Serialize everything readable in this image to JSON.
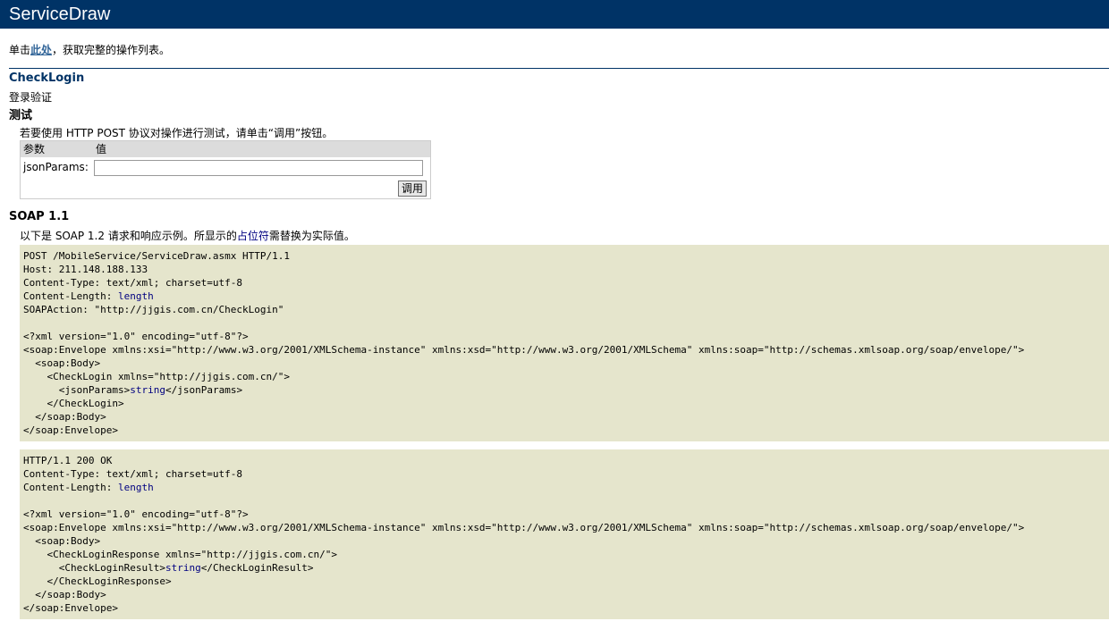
{
  "service": {
    "name": "ServiceDraw"
  },
  "intro": {
    "prefix": "单击",
    "link": "此处",
    "suffix": "，获取完整的操作列表。"
  },
  "operation": {
    "name": "CheckLogin",
    "description": "登录验证"
  },
  "test": {
    "heading": "测试",
    "instructions": "若要使用 HTTP POST 协议对操作进行测试，请单击“调用”按钮。",
    "col_param": "参数",
    "col_value": "值",
    "param_name": "jsonParams:",
    "param_value": "",
    "invoke_label": "调用"
  },
  "soap": {
    "heading": "SOAP 1.1",
    "note_a": "以下是 SOAP 1.2 请求和响应示例。所显示的",
    "note_link": "占位符",
    "note_b": "需替换为实际值。",
    "request": {
      "line1": "POST /MobileService/ServiceDraw.asmx HTTP/1.1",
      "line2": "Host: 211.148.188.133",
      "line3": "Content-Type: text/xml; charset=utf-8",
      "line4_prefix": "Content-Length: ",
      "line4_value": "length",
      "line5": "SOAPAction: \"http://jjgis.com.cn/CheckLogin\"",
      "line6": "<?xml version=\"1.0\" encoding=\"utf-8\"?>",
      "line7": "<soap:Envelope xmlns:xsi=\"http://www.w3.org/2001/XMLSchema-instance\" xmlns:xsd=\"http://www.w3.org/2001/XMLSchema\" xmlns:soap=\"http://schemas.xmlsoap.org/soap/envelope/\">",
      "line8": "  <soap:Body>",
      "line9": "    <CheckLogin xmlns=\"http://jjgis.com.cn/\">",
      "line10_prefix": "      <jsonParams>",
      "line10_value": "string",
      "line10_suffix": "</jsonParams>",
      "line11": "    </CheckLogin>",
      "line12": "  </soap:Body>",
      "line13": "</soap:Envelope>"
    },
    "response": {
      "line1": "HTTP/1.1 200 OK",
      "line2": "Content-Type: text/xml; charset=utf-8",
      "line3_prefix": "Content-Length: ",
      "line3_value": "length",
      "line4": "<?xml version=\"1.0\" encoding=\"utf-8\"?>",
      "line5": "<soap:Envelope xmlns:xsi=\"http://www.w3.org/2001/XMLSchema-instance\" xmlns:xsd=\"http://www.w3.org/2001/XMLSchema\" xmlns:soap=\"http://schemas.xmlsoap.org/soap/envelope/\">",
      "line6": "  <soap:Body>",
      "line7": "    <CheckLoginResponse xmlns=\"http://jjgis.com.cn/\">",
      "line8_prefix": "      <CheckLoginResult>",
      "line8_value": "string",
      "line8_suffix": "</CheckLoginResult>",
      "line9": "    </CheckLoginResponse>",
      "line10": "  </soap:Body>",
      "line11": "</soap:Envelope>"
    }
  },
  "colors": {
    "header_bg": "#003366",
    "code_bg": "#e5e5cc",
    "link": "#336699",
    "placeholder": "#000080"
  }
}
